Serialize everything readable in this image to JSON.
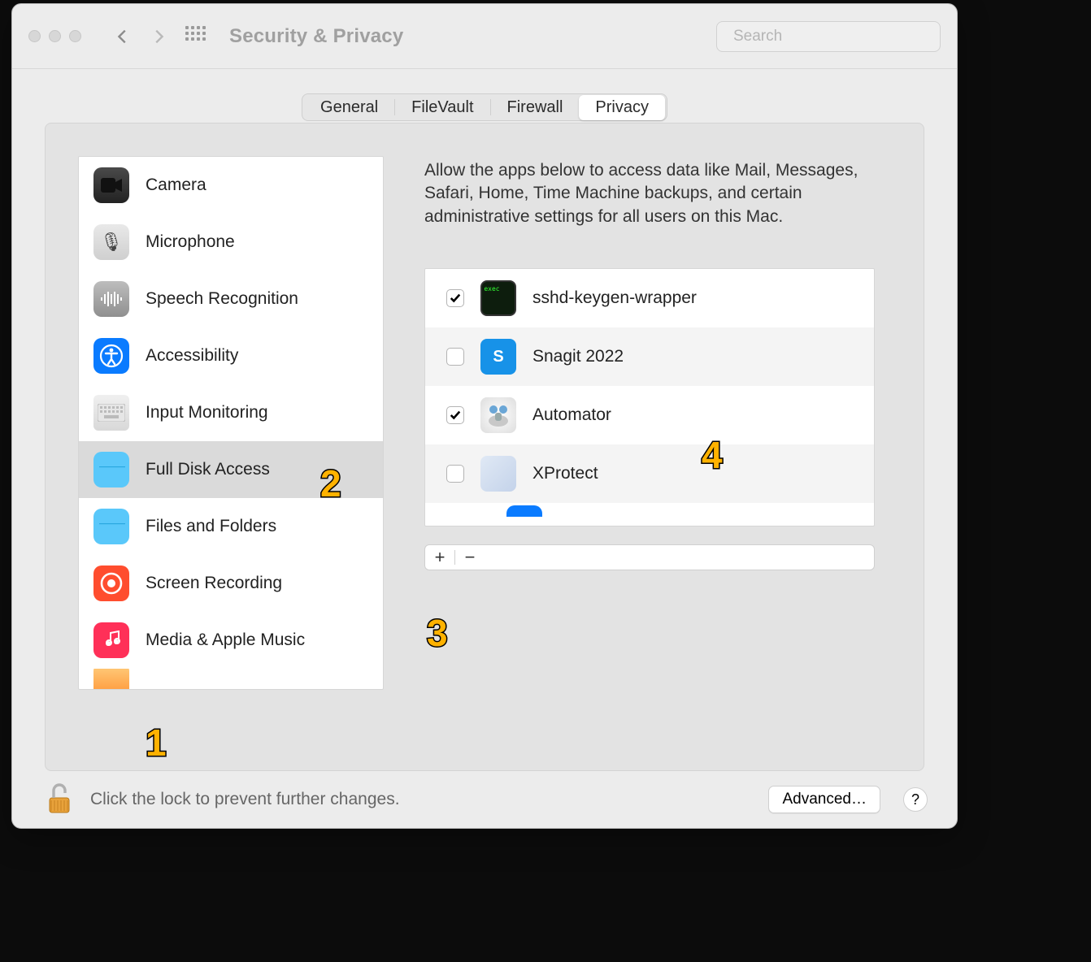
{
  "window": {
    "title": "Security & Privacy",
    "search_placeholder": "Search"
  },
  "tabs": [
    {
      "label": "General",
      "active": false
    },
    {
      "label": "FileVault",
      "active": false
    },
    {
      "label": "Firewall",
      "active": false
    },
    {
      "label": "Privacy",
      "active": true
    }
  ],
  "sidebar": {
    "items": [
      {
        "label": "Camera",
        "icon": "camera",
        "selected": false
      },
      {
        "label": "Microphone",
        "icon": "mic",
        "selected": false
      },
      {
        "label": "Speech Recognition",
        "icon": "speech",
        "selected": false
      },
      {
        "label": "Accessibility",
        "icon": "acc",
        "selected": false
      },
      {
        "label": "Input Monitoring",
        "icon": "keyboard",
        "selected": false
      },
      {
        "label": "Full Disk Access",
        "icon": "folder",
        "selected": true
      },
      {
        "label": "Files and Folders",
        "icon": "folder",
        "selected": false
      },
      {
        "label": "Screen Recording",
        "icon": "record",
        "selected": false
      },
      {
        "label": "Media & Apple Music",
        "icon": "music",
        "selected": false
      }
    ]
  },
  "detail": {
    "description": "Allow the apps below to access data like Mail, Messages, Safari, Home, Time Machine backups, and certain administrative settings for all users on this Mac.",
    "apps": [
      {
        "name": "sshd-keygen-wrapper",
        "checked": true,
        "icon": "term"
      },
      {
        "name": "Snagit 2022",
        "checked": false,
        "icon": "snagit"
      },
      {
        "name": "Automator",
        "checked": true,
        "icon": "auto"
      },
      {
        "name": "XProtect",
        "checked": false,
        "icon": "xprot"
      }
    ],
    "add_label": "+",
    "remove_label": "−"
  },
  "footer": {
    "lock_label": "Click the lock to prevent further changes.",
    "advanced_label": "Advanced…",
    "help_label": "?"
  },
  "annotations": {
    "a1": "1",
    "a2": "2",
    "a3": "3",
    "a4": "4"
  }
}
